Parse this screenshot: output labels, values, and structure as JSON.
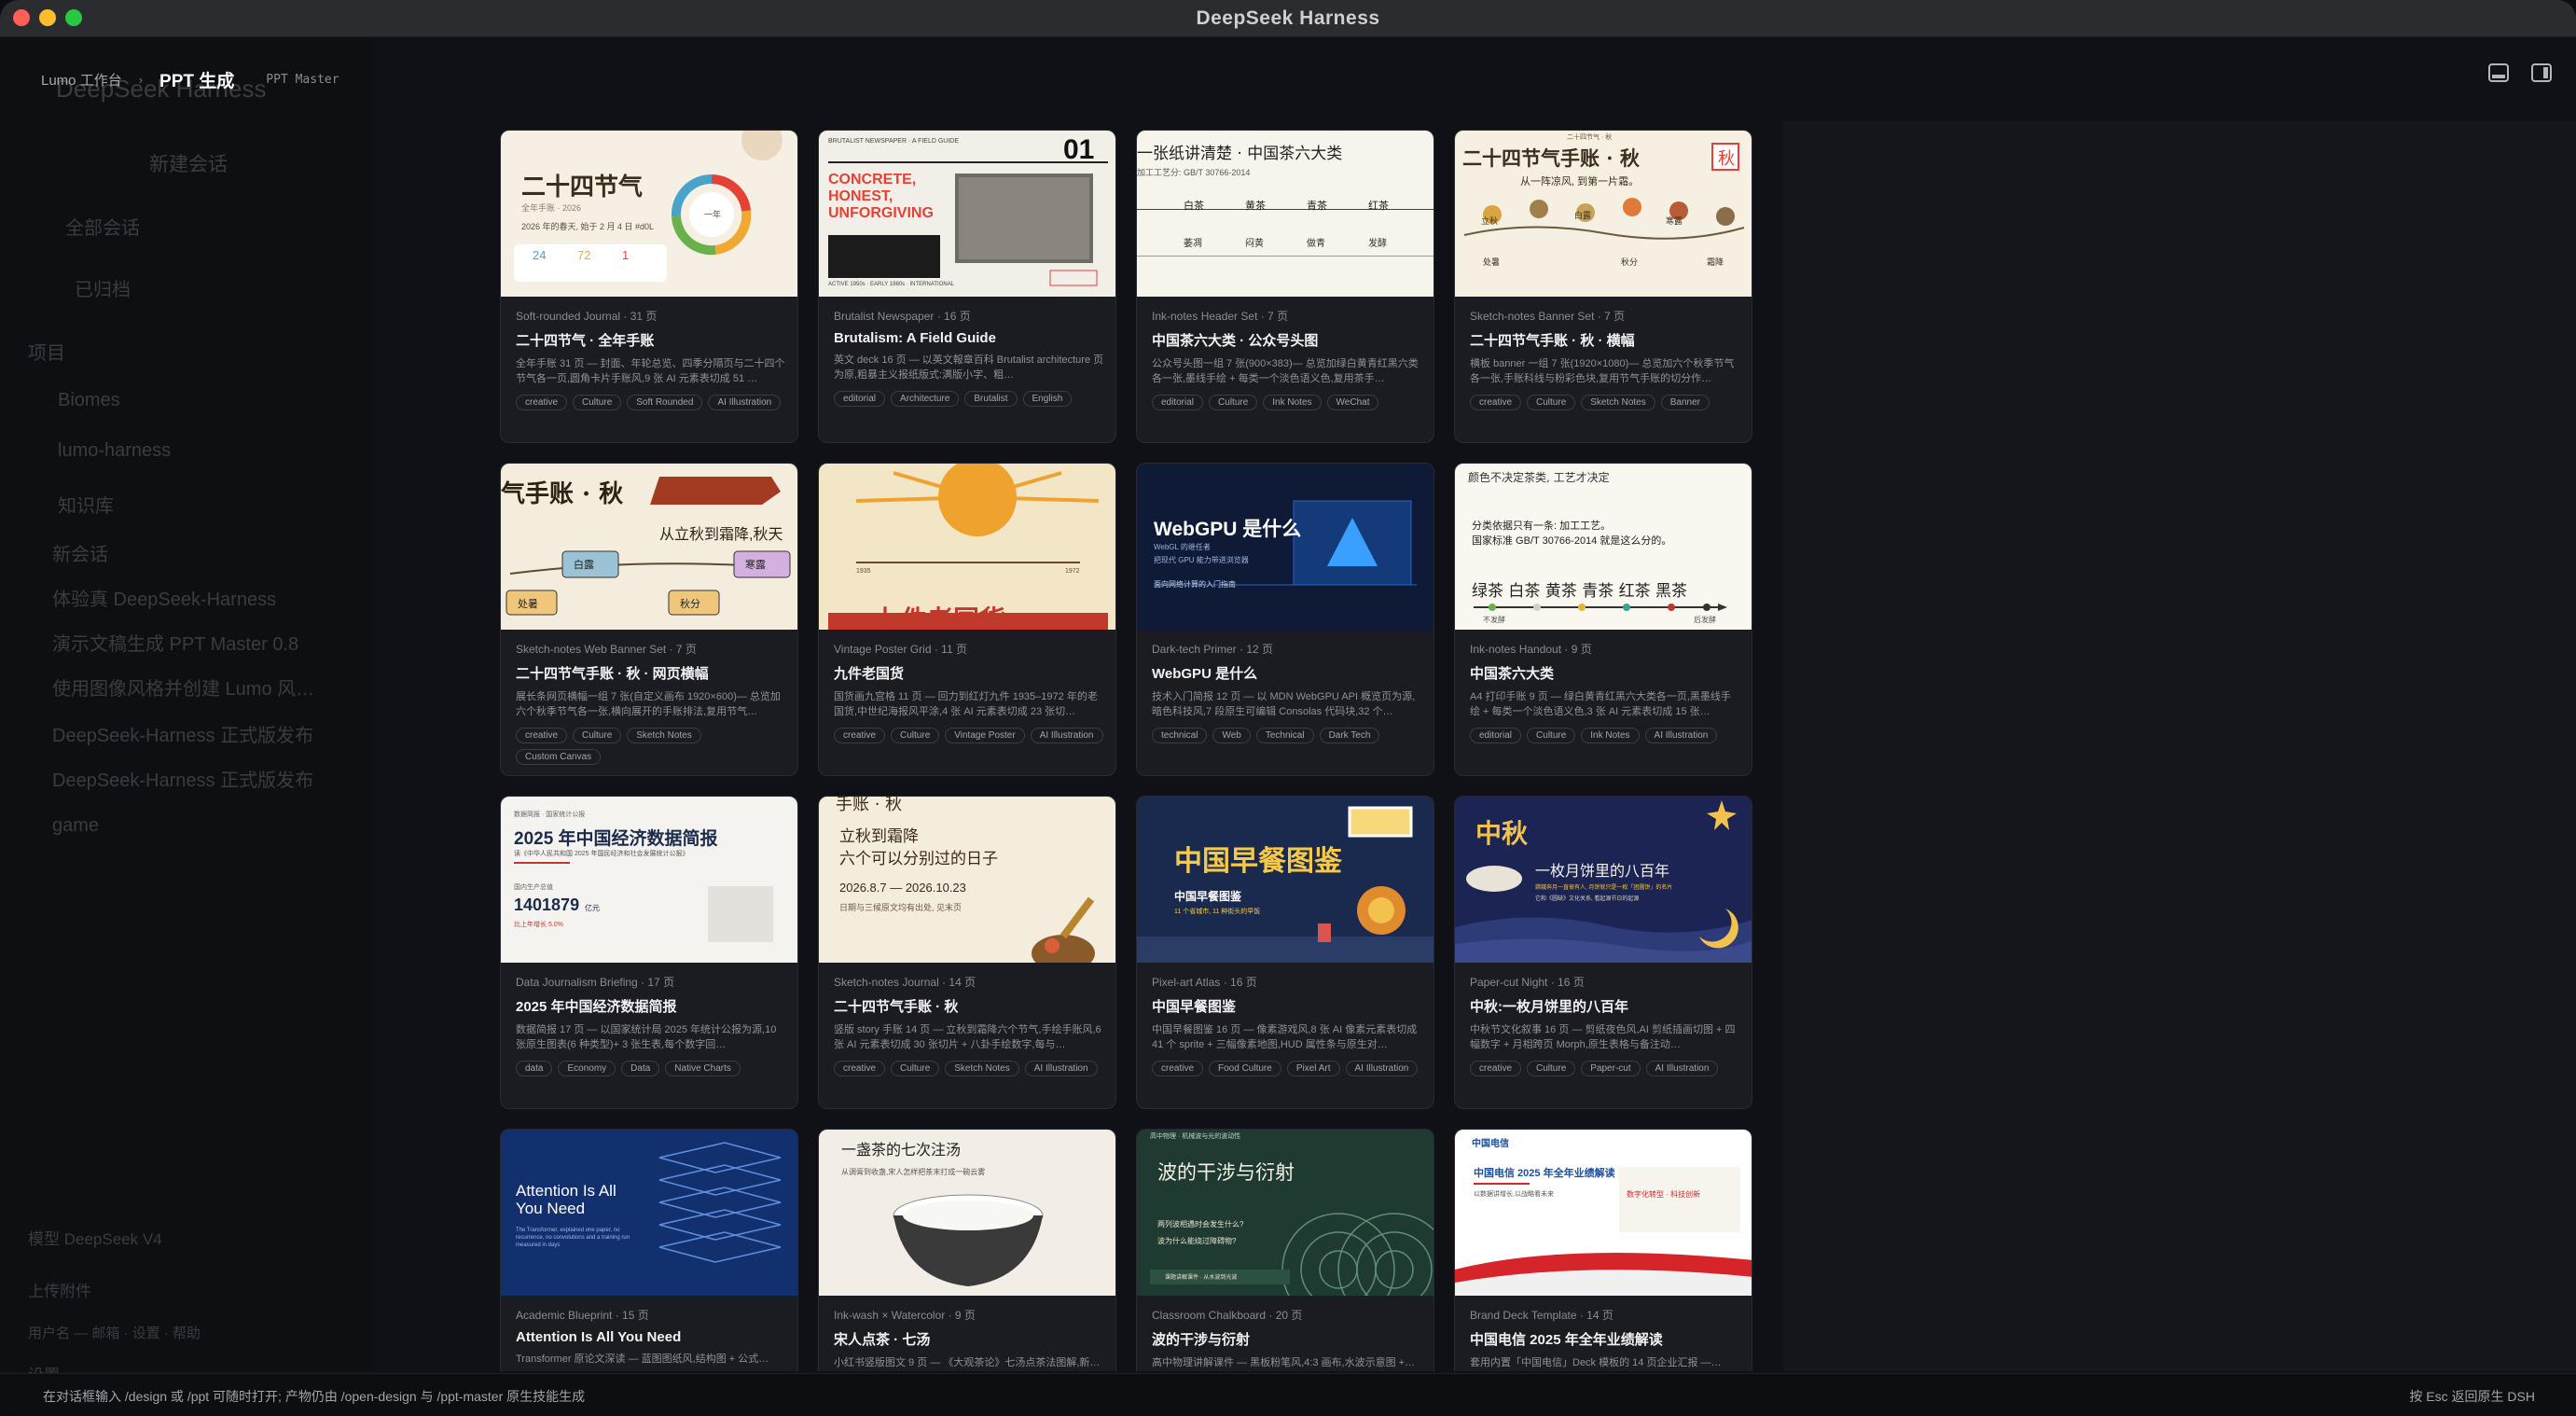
{
  "window": {
    "title": "DeepSeek Harness"
  },
  "breadcrumb": {
    "workspace": "Lumo 工作台",
    "current": "PPT 生成",
    "tag": "PPT Master"
  },
  "background_sidebar": {
    "header": "DeepSeek Harness",
    "new_session": "新建会话",
    "items": [
      "全部会话",
      "已归档",
      "项目",
      "Biomes",
      "lumo-harness",
      "知识库",
      "新会话",
      "体验真 DeepSeek-Harness",
      "演示文稿生成 PPT Master 0.8",
      "使用图像风格并创建 Lumo 风…",
      "DeepSeek-Harness 正式版发布",
      "DeepSeek-Harness 正式版发布",
      "game"
    ],
    "footer": [
      "模型 DeepSeek V4",
      "上传附件",
      "用户名 — 邮箱 · 设置 · 帮助",
      "设置"
    ]
  },
  "cards": [
    {
      "subtitle": "Soft-rounded Journal · 31 页",
      "title": "二十四节气 · 全年手账",
      "desc": "全年手账 31 页 — 封面、年轮总览、四季分隔页与二十四个节气各一页,圆角卡片手账风,9 张 AI 元素表切成 51 …",
      "tags": [
        "creative",
        "Culture",
        "Soft Rounded",
        "AI Illustration"
      ]
    },
    {
      "subtitle": "Brutalist Newspaper · 16 页",
      "title": "Brutalism: A Field Guide",
      "desc": "英文 deck 16 页 — 以英文報章百科 Brutalist architecture 页为原,粗暴主义报纸版式:满版小字、粗…",
      "tags": [
        "editorial",
        "Architecture",
        "Brutalist",
        "English"
      ]
    },
    {
      "subtitle": "Ink-notes Header Set · 7 页",
      "title": "中国茶六大类 · 公众号头图",
      "desc": "公众号头图一组 7 张(900×383)— 总览加绿白黄青红黑六类各一张,墨线手绘 + 每类一个淡色语义色,复用茶手…",
      "tags": [
        "editorial",
        "Culture",
        "Ink Notes",
        "WeChat"
      ]
    },
    {
      "subtitle": "Sketch-notes Banner Set · 7 页",
      "title": "二十四节气手账 · 秋 · 横幅",
      "desc": "横板 banner 一组 7 张(1920×1080)— 总览加六个秋季节气各一张,手账科线与粉彩色块,复用节气手账的切分作…",
      "tags": [
        "creative",
        "Culture",
        "Sketch Notes",
        "Banner"
      ]
    },
    {
      "subtitle": "Sketch-notes Web Banner Set · 7 页",
      "title": "二十四节气手账 · 秋 · 网页横幅",
      "desc": "展长条网页横幅一组 7 张(自定义画布 1920×600)— 总览加六个秋季节气各一张,横向展开的手账排法,复用节气…",
      "tags": [
        "creative",
        "Culture",
        "Sketch Notes",
        "Custom Canvas"
      ]
    },
    {
      "subtitle": "Vintage Poster Grid · 11 页",
      "title": "九件老国货",
      "desc": "国货画九宫格 11 页 — 回力到红灯九件 1935–1972 年的老国货,中世纪海报风平涂,4 张 AI 元素表切成 23 张切…",
      "tags": [
        "creative",
        "Culture",
        "Vintage Poster",
        "AI Illustration"
      ]
    },
    {
      "subtitle": "Dark-tech Primer · 12 页",
      "title": "WebGPU 是什么",
      "desc": "技术入门简报 12 页 — 以 MDN WebGPU API 概览页为源,暗色科技风,7 段原生可编辑 Consolas 代码块,32 个…",
      "tags": [
        "technical",
        "Web",
        "Technical",
        "Dark Tech"
      ]
    },
    {
      "subtitle": "Ink-notes Handout · 9 页",
      "title": "中国茶六大类",
      "desc": "A4 打印手账 9 页 — 绿白黄青红黑六大类各一页,黑墨线手绘 + 每类一个淡色语义色,3 张 AI 元素表切成 15 张…",
      "tags": [
        "editorial",
        "Culture",
        "Ink Notes",
        "AI Illustration"
      ]
    },
    {
      "subtitle": "Data Journalism Briefing · 17 页",
      "title": "2025 年中国经济数据简报",
      "desc": "数据简报 17 页 — 以国家统计局 2025 年统计公报为源,10 张原生图表(6 种类型)+ 3 张生表,每个数字回…",
      "tags": [
        "data",
        "Economy",
        "Data",
        "Native Charts"
      ]
    },
    {
      "subtitle": "Sketch-notes Journal · 14 页",
      "title": "二十四节气手账 · 秋",
      "desc": "竖版 story 手账 14 页 — 立秋到霜降六个节气,手绘手账风,6 张 AI 元素表切成 30 张切片 + 八卦手绘数字,每与…",
      "tags": [
        "creative",
        "Culture",
        "Sketch Notes",
        "AI Illustration"
      ]
    },
    {
      "subtitle": "Pixel-art Atlas · 16 页",
      "title": "中国早餐图鉴",
      "desc": "中国早餐图鉴 16 页 — 像素游戏风,8 张 AI 像素元素表切成 41 个 sprite + 三幅像素地图,HUD 属性条与原生对…",
      "tags": [
        "creative",
        "Food Culture",
        "Pixel Art",
        "AI Illustration"
      ]
    },
    {
      "subtitle": "Paper-cut Night · 16 页",
      "title": "中秋:一枚月饼里的八百年",
      "desc": "中秋节文化叙事 16 页 — 剪纸夜色风,AI 剪纸插画切图 + 四幅数字 + 月相跨页 Morph,原生表格与备注动…",
      "tags": [
        "creative",
        "Culture",
        "Paper-cut",
        "AI Illustration"
      ]
    },
    {
      "subtitle": "Academic Blueprint · 15 页",
      "title": "Attention Is All You Need",
      "desc": "Transformer 原论文深读 — 蓝图图纸风,结构图 + 公式…",
      "tags": []
    },
    {
      "subtitle": "Ink-wash × Watercolor · 9 页",
      "title": "宋人点茶 · 七汤",
      "desc": "小红书竖版图文 9 页 — 《大观茶论》七汤点茶法图解,新…",
      "tags": []
    },
    {
      "subtitle": "Classroom Chalkboard · 20 页",
      "title": "波的干涉与衍射",
      "desc": "高中物理讲解课件 — 黑板粉笔风,4:3 画布,水波示意图 +…",
      "tags": []
    },
    {
      "subtitle": "Brand Deck Template · 14 页",
      "title": "中国电信 2025 年全年业绩解读",
      "desc": "套用内置「中国电信」Deck 模板的 14 页企业汇报 —…",
      "tags": []
    }
  ],
  "thumbs": {
    "t1": {
      "title": "二十四节气",
      "sub": "全年手账 · 2026",
      "line": "2026 年的春天, 始于 2 月 4 日 #d0L",
      "n1": "24",
      "n2": "72",
      "n3": "1",
      "ring": "一年"
    },
    "t2": {
      "kicker": "BRUTALIST NEWSPAPER · A FIELD GUIDE",
      "num": "01",
      "head": "CONCRETE, HONEST, UNFORGIVING",
      "foot": "ACTIVE 1950s · EARLY 1980s · INTERNATIONAL"
    },
    "t3": {
      "head": "一张纸讲清楚 · 中国茶六大类",
      "sub": "加工工艺分: GB/T 30766-2014",
      "cols": [
        "白茶",
        "黄茶",
        "青茶",
        "红茶"
      ],
      "row1": [
        "萎凋",
        "闷黄",
        "做青",
        "发酵"
      ]
    },
    "t4": {
      "kicker": "二十四节气 · 秋",
      "head": "二十四节气手账 · 秋",
      "stamp": "秋",
      "sub": "从一阵凉风, 到第一片霜。",
      "items": [
        "立秋",
        "处暑",
        "白露",
        "秋分",
        "寒露",
        "霜降"
      ]
    },
    "t5": {
      "head": "气手账 · 秋",
      "sub": "从立秋到霜降,秋天",
      "a": "白露",
      "b": "寒露",
      "c": "处暑",
      "d": "秋分"
    },
    "t6": {
      "head": "九件老国货",
      "l": "1935",
      "r": "1972"
    },
    "t7": {
      "head": "WebGPU 是什么",
      "sub": "WebGL 的继任者",
      "sub2": "把现代 GPU 能力带进浏览器",
      "foot": "面向网络计算的入门指南"
    },
    "t8": {
      "l1": "颜色不决定茶类, 工艺才决定",
      "l2": "分类依据只有一条: 加工工艺。",
      "l3": "国家标准 GB/T 30766-2014 就是这么分的。",
      "teas": "绿茶 白茶 黄茶 青茶 红茶 黑茶",
      "a": "不发酵",
      "b": "后发酵"
    },
    "t9": {
      "kicker": "数据简报 · 国家统计公报",
      "head": "2025 年中国经济数据简报",
      "sub": "读《中华人民共和国 2025 年国民经济和社会发展统计公报》",
      "lbl": "国内生产总值",
      "num": "1401879",
      "unit": "亿元",
      "growth": "比上年增长 5.0%"
    },
    "t10": {
      "top": "手账 · 秋",
      "l1": "立秋到霜降",
      "l2": "六个可以分别过的日子",
      "date": "2026.8.7 — 2026.10.23",
      "sub": "日期与三候原文均有出处, 见末页"
    },
    "t11": {
      "head": "中国早餐图鉴",
      "sub": "中国早餐图鉴",
      "sub2": "11 个省城市, 11 种街头的早饭"
    },
    "t12": {
      "head": "中秋",
      "l1": "一枚月饼里的八百年",
      "l2": "嫦娥奔月一直很有人, 月饼就只是一枚「团圆饼」的名片",
      "l3": "它和《圆缺》文化关系, 看起源节日的起源"
    },
    "t13": {
      "head": "Attention Is All You Need",
      "sub": "The Transformer, explained one paper, no recurrence, no convolutions and a training run measured in days"
    },
    "t14": {
      "head": "一盏茶的七次注汤",
      "sub": "从调膏到收盏,宋人怎样把茶末打成一碗云雾"
    },
    "t15": {
      "kicker": "高中物理 · 机械波与光的波动性",
      "head": "波的干涉与衍射",
      "q1": "两列波相遇时会发生什么?",
      "q2": "波为什么能绕过障碍物?",
      "foot": "课题讲解课件 · 从水波到光波"
    },
    "t16": {
      "logo": "中国电信",
      "head": "中国电信 2025 年全年业绩解读",
      "sub": "以数据讲增长,以战略看未来",
      "stamp": "数字化转型 · 科技创新"
    }
  },
  "statusbar": {
    "left": "在对话框输入 /design 或 /ppt 可随时打开; 产物仍由 /open-design 与 /ppt-master 原生技能生成",
    "right": "按 Esc 返回原生 DSH"
  },
  "colors": {
    "accent_red": "#e34234",
    "paper": "#f6f0e4",
    "dark_card": "#1b1c22"
  }
}
